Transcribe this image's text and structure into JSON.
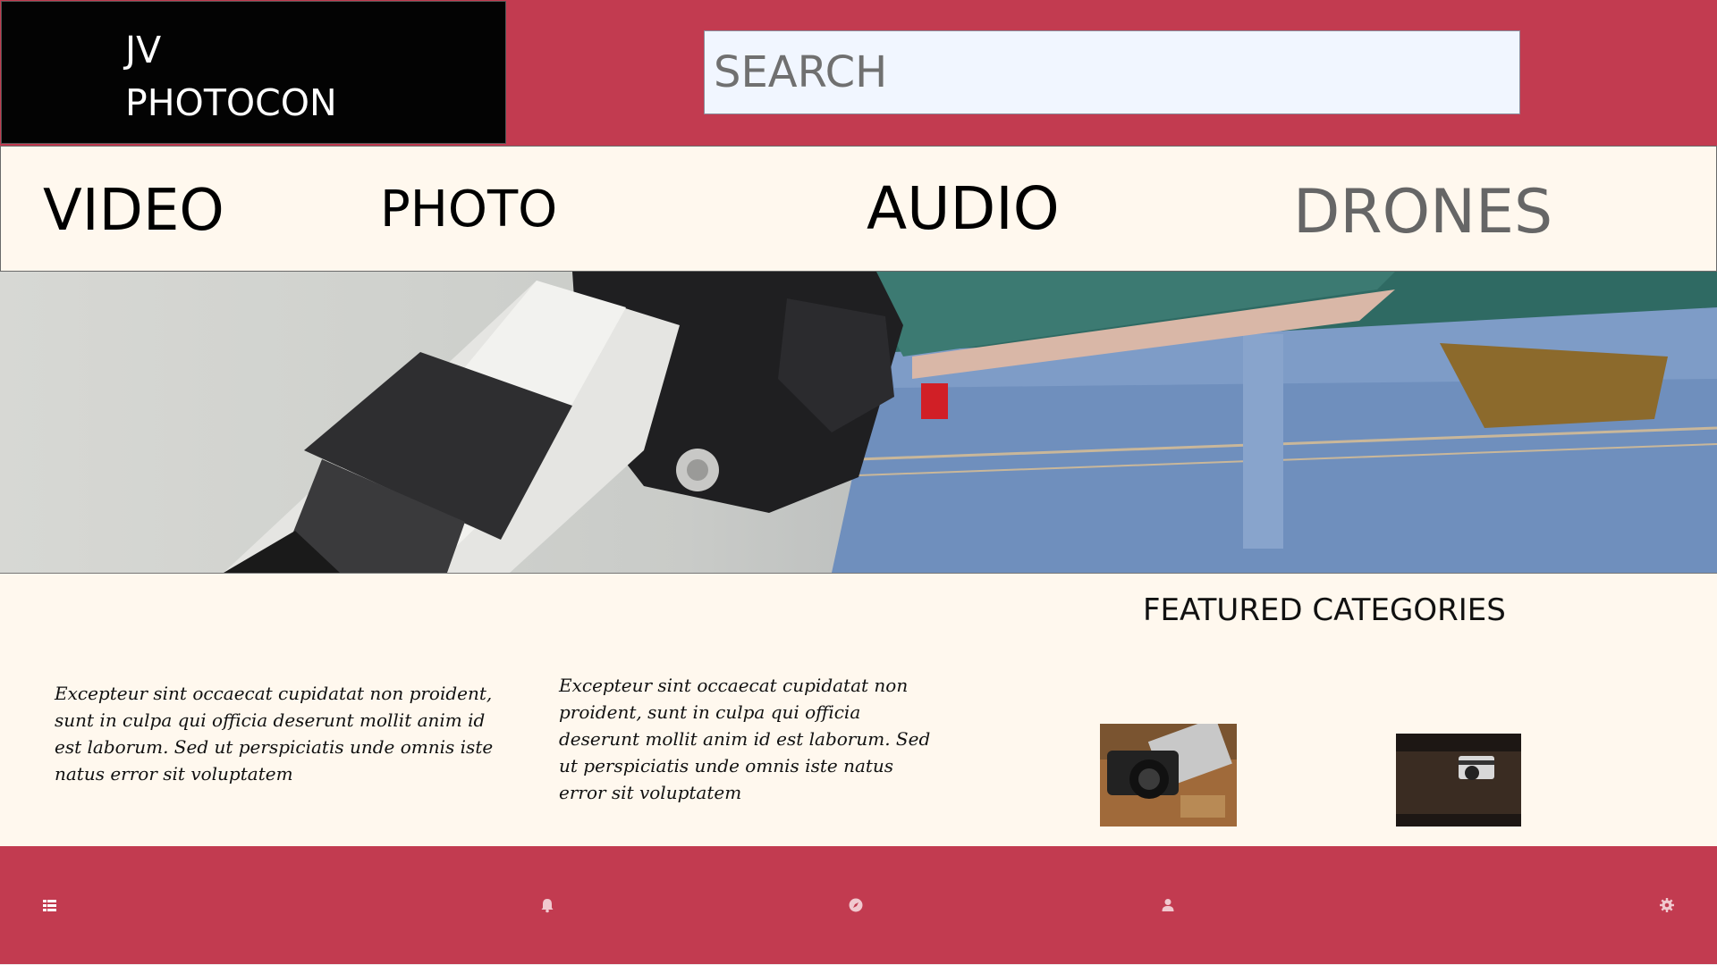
{
  "header": {
    "logo_line1": "JV",
    "logo_line2": "PHOTOCON",
    "search_placeholder": "SEARCH",
    "background_color": "#c23b50"
  },
  "nav": {
    "items": [
      {
        "label": "VIDEO"
      },
      {
        "label": "PHOTO"
      },
      {
        "label": "AUDIO"
      },
      {
        "label": "DRONES"
      }
    ]
  },
  "main": {
    "featured_title": "FEATURED CATEGORIES",
    "paragraphs": [
      "Excepteur sint occaecat cupidatat non proident, sunt in culpa qui officia deserunt mollit anim id est laborum. Sed ut perspiciatis unde omnis iste natus error sit voluptatem",
      "Excepteur sint occaecat cupidatat non proident, sunt in culpa qui officia deserunt mollit anim id est laborum. Sed ut perspiciatis unde omnis iste natus error sit voluptatem"
    ]
  },
  "footer": {
    "icons": [
      "list-icon",
      "bell-icon",
      "compass-icon",
      "person-icon",
      "gear-icon"
    ]
  }
}
